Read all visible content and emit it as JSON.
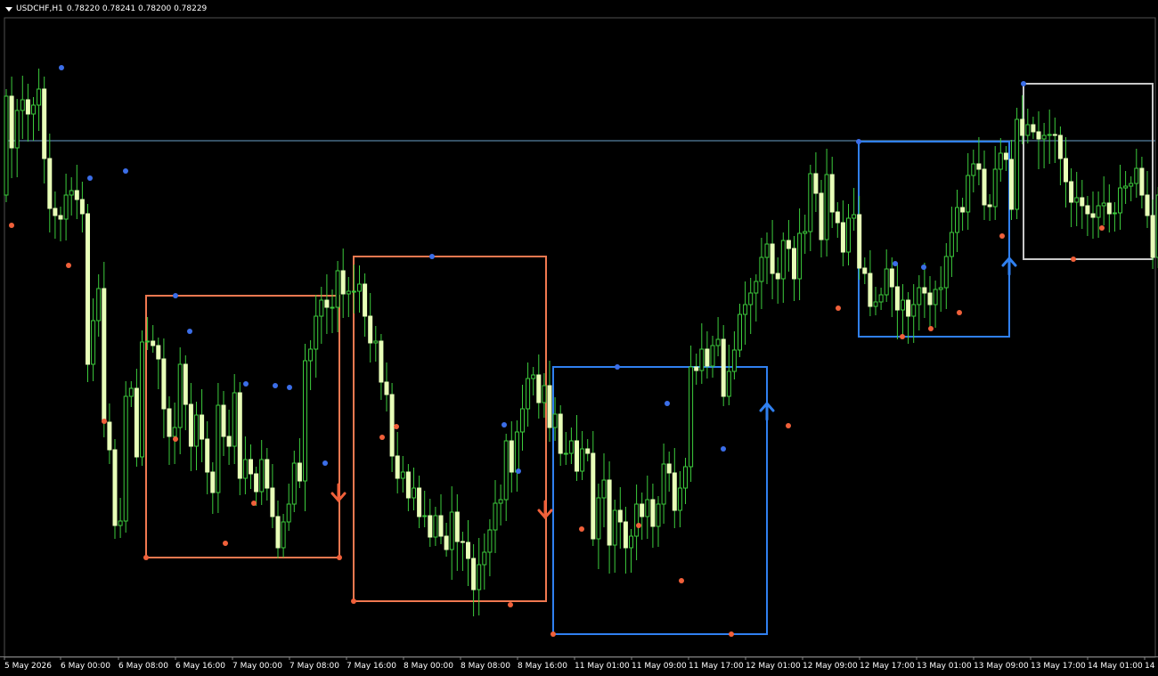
{
  "header": {
    "symbol": "USDCHF,H1",
    "ohlc": "0.78220 0.78241 0.78200 0.78229"
  },
  "colors": {
    "background": "#000000",
    "bull_body": "#e8ffb8",
    "wick": "#3dcc3d",
    "bear_outline": "#3dcc3d",
    "swing_high_dot": "#3b6ee8",
    "swing_low_dot": "#f0603a",
    "bearish_box": "#f07850",
    "bullish_box": "#3080f0",
    "neutral_box": "#c8c8c8",
    "bid_line": "#6aa0c8"
  },
  "chart_data": {
    "type": "candlestick",
    "timeframe": "H1",
    "x_tick_labels": [
      "5 May 2026",
      "6 May 00:00",
      "6 May 08:00",
      "6 May 16:00",
      "7 May 00:00",
      "7 May 08:00",
      "7 May 16:00",
      "8 May 00:00",
      "8 May 08:00",
      "8 May 16:00",
      "11 May 01:00",
      "11 May 09:00",
      "11 May 17:00",
      "12 May 01:00",
      "12 May 09:00",
      "12 May 17:00",
      "13 May 01:00",
      "13 May 09:00",
      "13 May 17:00",
      "14 May 01:00",
      "14 M"
    ],
    "closes": [
      219,
      108,
      166,
      124,
      112,
      128,
      118,
      100,
      178,
      234,
      242,
      246,
      219,
      214,
      224,
      240,
      409,
      360,
      324,
      474,
      505,
      590,
      585,
      445,
      436,
      513,
      384,
      383,
      388,
      403,
      459,
      490,
      480,
      409,
      454,
      501,
      466,
      493,
      530,
      553,
      455,
      490,
      501,
      441,
      537,
      516,
      532,
      552,
      516,
      548,
      580,
      615,
      586,
      566,
      520,
      540,
      405,
      392,
      355,
      337,
      345,
      345,
      304,
      330,
      327,
      327,
      319,
      355,
      385,
      383,
      429,
      443,
      512,
      537,
      530,
      559,
      548,
      580,
      579,
      603,
      579,
      602,
      617,
      575,
      608,
      609,
      627,
      662,
      634,
      620,
      595,
      565,
      561,
      495,
      530,
      485,
      459,
      425,
      421,
      452,
      433,
      480,
      465,
      509,
      509,
      495,
      529,
      504,
      509,
      605,
      559,
      539,
      612,
      573,
      586,
      615,
      602,
      566,
      580,
      561,
      591,
      566,
      521,
      531,
      573,
      548,
      524,
      412,
      416,
      392,
      411,
      388,
      381,
      445,
      417,
      393,
      353,
      342,
      329,
      316,
      289,
      274,
      307,
      313,
      270,
      279,
      313,
      262,
      260,
      195,
      217,
      269,
      196,
      238,
      250,
      283,
      245,
      241,
      301,
      307,
      344,
      339,
      331,
      302,
      322,
      348,
      337,
      355,
      342,
      323,
      329,
      342,
      325,
      323,
      288,
      261,
      233,
      238,
      197,
      184,
      190,
      230,
      232,
      190,
      172,
      179,
      235,
      134,
      152,
      140,
      148,
      156,
      152,
      151,
      152,
      178,
      204,
      227,
      222,
      231,
      240,
      244,
      231,
      228,
      240,
      239,
      211,
      209,
      206,
      189,
      219,
      242,
      289
    ],
    "opens": [
      108,
      166,
      124,
      112,
      128,
      118,
      100,
      178,
      234,
      242,
      246,
      219,
      214,
      224,
      240,
      409,
      360,
      324,
      474,
      505,
      590,
      585,
      445,
      436,
      513,
      384,
      383,
      388,
      403,
      459,
      490,
      480,
      409,
      454,
      501,
      466,
      493,
      530,
      553,
      455,
      490,
      501,
      441,
      537,
      516,
      532,
      552,
      516,
      548,
      580,
      615,
      586,
      566,
      520,
      540,
      405,
      392,
      355,
      337,
      345,
      345,
      304,
      330,
      327,
      327,
      319,
      355,
      385,
      383,
      429,
      443,
      512,
      537,
      530,
      559,
      548,
      580,
      579,
      603,
      579,
      602,
      617,
      575,
      608,
      609,
      627,
      662,
      634,
      620,
      595,
      565,
      561,
      495,
      530,
      485,
      459,
      425,
      421,
      452,
      433,
      480,
      465,
      509,
      509,
      495,
      529,
      504,
      509,
      605,
      559,
      539,
      612,
      573,
      586,
      615,
      602,
      566,
      580,
      561,
      591,
      566,
      521,
      531,
      573,
      548,
      524,
      412,
      416,
      392,
      411,
      388,
      381,
      445,
      417,
      393,
      353,
      342,
      329,
      316,
      289,
      274,
      307,
      313,
      270,
      279,
      313,
      262,
      260,
      195,
      217,
      269,
      196,
      238,
      250,
      283,
      245,
      241,
      301,
      307,
      344,
      339,
      331,
      302,
      322,
      348,
      337,
      355,
      342,
      323,
      329,
      342,
      325,
      323,
      288,
      261,
      233,
      238,
      197,
      184,
      190,
      230,
      232,
      190,
      172,
      179,
      235,
      134,
      152,
      140,
      148,
      156,
      152,
      151,
      152,
      178,
      204,
      227,
      222,
      231,
      240,
      244,
      231,
      228,
      240,
      239,
      211,
      209,
      206,
      189,
      219,
      242,
      289,
      219
    ],
    "bid_line_level": 158
  }
}
